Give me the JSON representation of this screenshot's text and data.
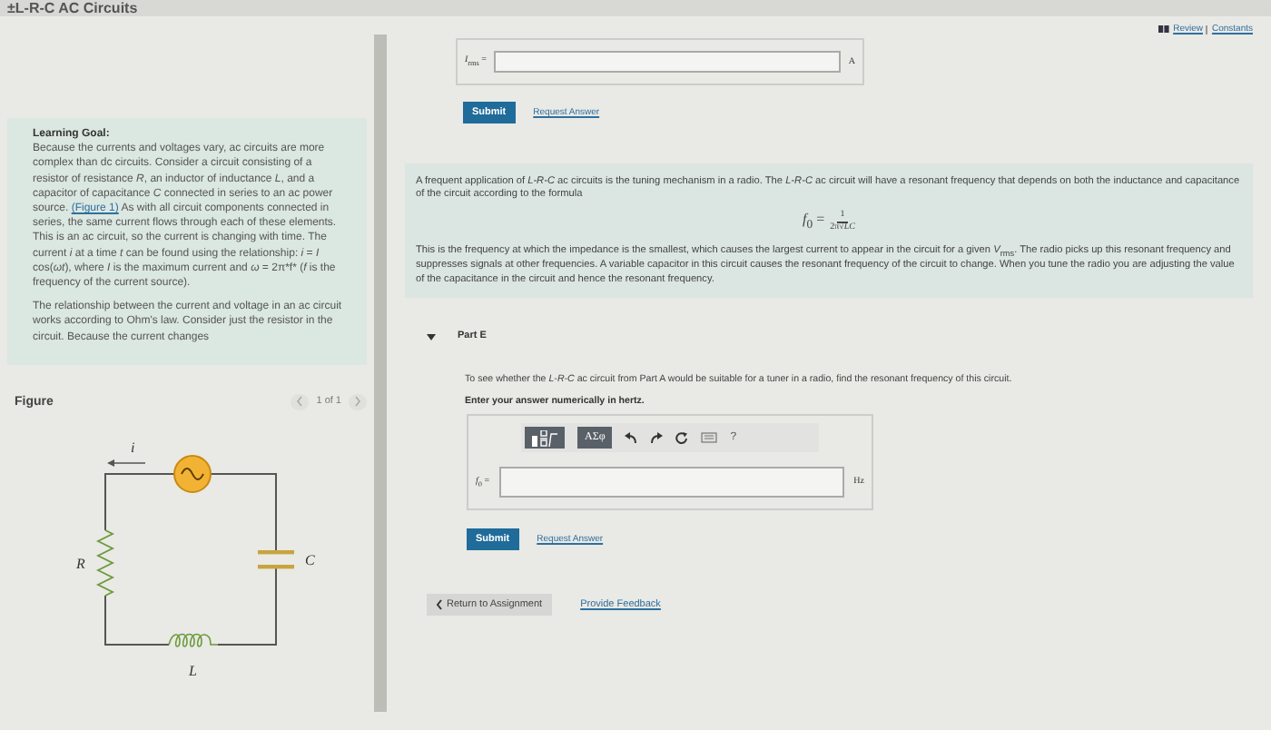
{
  "header": {
    "title": "±L-R-C AC Circuits"
  },
  "learning_goal": {
    "heading": "Learning Goal:",
    "paragraph_1": {
      "before": "Because the currents and voltages vary, ac circuits are more complex than dc circuits. Consider a circuit consisting of a resistor of resistance *R*, an inductor of inductance *L*, and a capacitor of capacitance *C* connected in series to an ac power source.",
      "link": "(Figure 1)",
      "after": "As with all circuit components connected in series, the same current flows through each of these elements. This is an ac circuit, so the current is changing with time. The current *i* at a time *t* can be found using the relationship: *i* = *I* cos(*ωt*), where *I* is the maximum current and *ω* = 2π*f* (*f* is the frequency of the current source)."
    },
    "paragraph_2": "The relationship between the current and voltage in an ac circuit works according to Ohm's law. Consider just the resistor in the circuit. Because the current changes"
  },
  "figure": {
    "title": "Figure",
    "pager": "1 of 1",
    "current_label": "i",
    "resistor_label": "R",
    "capacitor_label": "C",
    "inductor_label": "L"
  },
  "top_links": [
    "Review",
    "Constants"
  ],
  "previous_answer": {
    "label": "*I*$_{rms}$ =",
    "unit": "A",
    "submit": "Submit",
    "request": "Request Answer"
  },
  "info_box": {
    "paragraph_1": "A frequent application of *L-R-C* ac circuits is the tuning mechanism in a radio. The *L-R-C* ac circuit will have a resonant frequency that depends on both the inductance and capacitance of the circuit according to the formula",
    "formula": {
      "lhs": "*f*$_{0}$ =",
      "numerator": "1",
      "denominator": "2π√*LC*"
    },
    "paragraph_2": "This is the frequency at which the impedance is the smallest, which causes the largest current to appear in the circuit for a given *V*$_{rms}$. The radio picks up this resonant frequency and suppresses signals at other frequencies. A variable capacitor in this circuit causes the resonant frequency of the circuit to change. When you tune the radio you are adjusting the value of the capacitance in the circuit and hence the resonant frequency."
  },
  "part": {
    "title": "Part E",
    "expanded": true,
    "question": "To see whether the *L-R-C* ac circuit from Part A would be suitable for a tuner in a radio, find the resonant frequency of this circuit.",
    "instruction": "Enter your answer numerically in hertz.",
    "symbols_button": "ΑΣφ",
    "help_button": "?",
    "label": "*f*$_{0}$ =",
    "unit": "Hz",
    "submit": "Submit",
    "request": "Request Answer"
  },
  "footer": {
    "return": "Return to Assignment",
    "feedback": "Provide Feedback"
  }
}
